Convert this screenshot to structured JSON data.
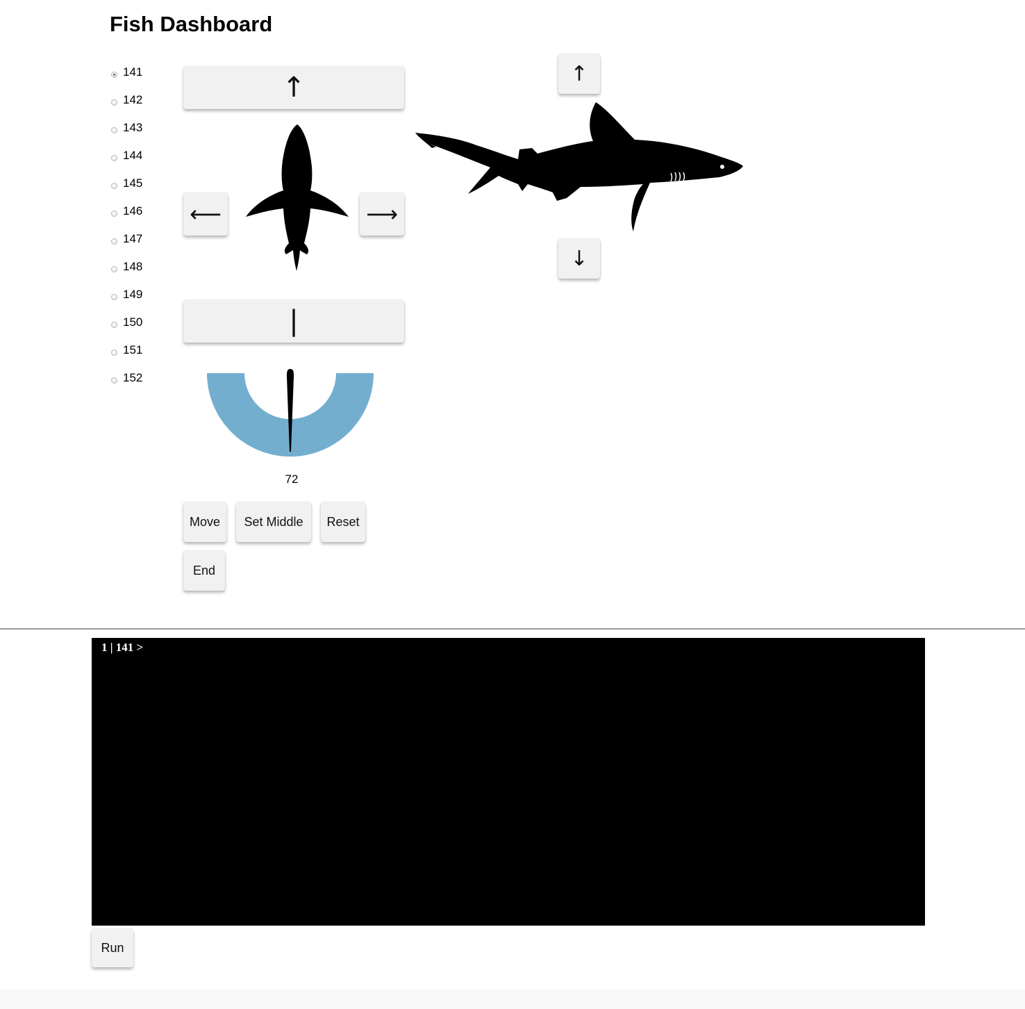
{
  "page": {
    "title": "Fish Dashboard"
  },
  "fish_ids": [
    {
      "label": "141",
      "checked": true
    },
    {
      "label": "142",
      "checked": false
    },
    {
      "label": "143",
      "checked": false
    },
    {
      "label": "144",
      "checked": false
    },
    {
      "label": "145",
      "checked": false
    },
    {
      "label": "146",
      "checked": false
    },
    {
      "label": "147",
      "checked": false
    },
    {
      "label": "148",
      "checked": false
    },
    {
      "label": "149",
      "checked": false
    },
    {
      "label": "150",
      "checked": false
    },
    {
      "label": "151",
      "checked": false
    },
    {
      "label": "152",
      "checked": false
    }
  ],
  "controls": {
    "forward": "↑",
    "left": "⟵",
    "right": "⟶",
    "stop": "|",
    "up": "↑",
    "down": "↓"
  },
  "gauge": {
    "value": "72",
    "color": "#73aecf"
  },
  "actions": {
    "move": "Move",
    "set_middle": "Set Middle",
    "reset": "Reset",
    "end": "End"
  },
  "console": {
    "prompt": "1 | 141 >"
  },
  "run_button": "Run",
  "icons": {
    "top_view": "shark-top-view-icon",
    "side_view": "shark-side-view-icon"
  }
}
